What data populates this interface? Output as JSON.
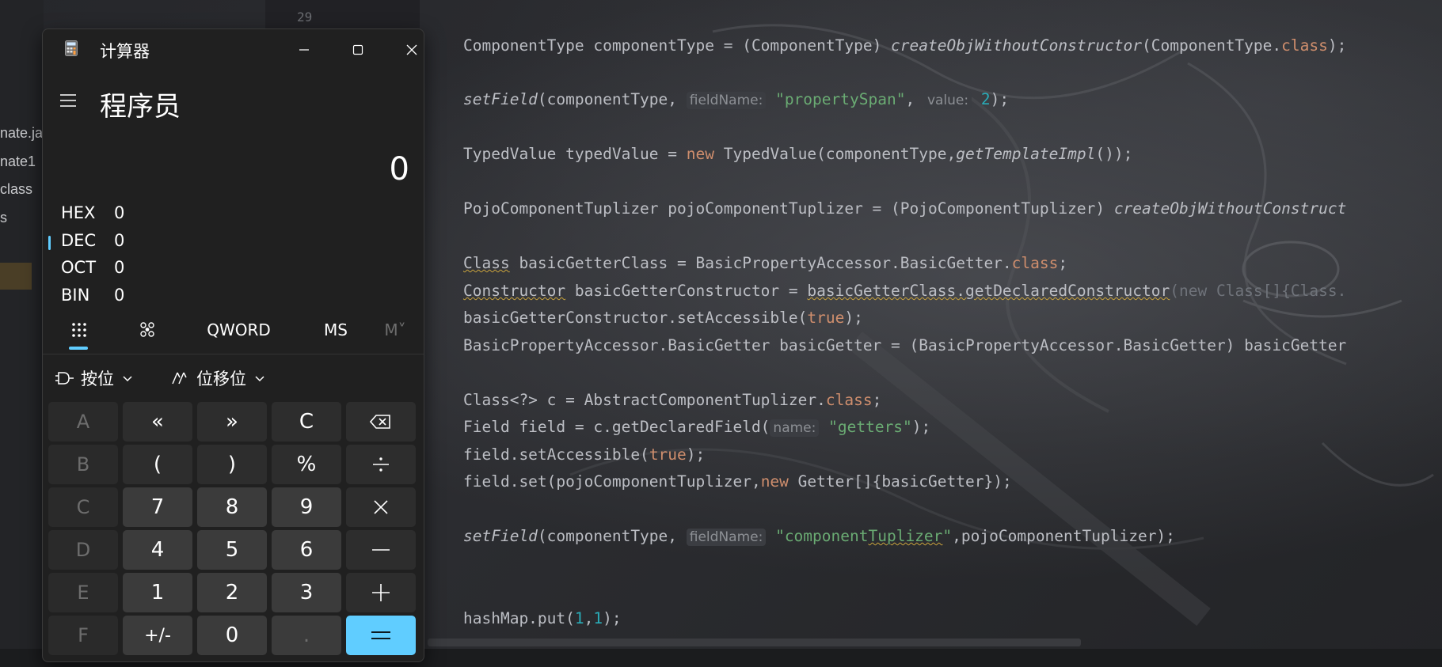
{
  "ide": {
    "gutter_line_number": "29",
    "project_items": [
      "nate.ja",
      "nate1",
      "class",
      "s"
    ],
    "code": {
      "line1": {
        "type": "ComponentType",
        "var": " componentType = (ComponentType) ",
        "call": "createObjWithoutConstructor",
        "arg": "(ComponentType.",
        "kw": "class",
        "end": ");"
      },
      "line2": {
        "call": "setField",
        "a": "(componentType, ",
        "hint1": "fieldName:",
        "s1": "\"propertySpan\"",
        "c": ", ",
        "hint2": "value:",
        "n": "2",
        "end": ");"
      },
      "line3": {
        "a": "TypedValue typedValue = ",
        "kw": "new",
        "b": " TypedValue(componentType,",
        "call": "getTemplateImpl",
        "end": "());"
      },
      "line4": {
        "a": "PojoComponentTuplizer pojoComponentTuplizer = (PojoComponentTuplizer) ",
        "call": "createObjWithoutConstruct"
      },
      "line5": {
        "a": "Class",
        "b": " basicGetterClass = BasicPropertyAccessor.BasicGetter.",
        "kw": "class",
        "end": ";"
      },
      "line6": {
        "a": "Constructor",
        "b": " basicGetterConstructor = ",
        "c": "basicGetterClass.getDeclaredConstructor",
        "d": "(new Class[]{Class."
      },
      "line7": {
        "a": "basicGetterConstructor.setAccessible(",
        "kw": "true",
        "end": ");"
      },
      "line8": {
        "a": "BasicPropertyAccessor.BasicGetter basicGetter = (BasicPropertyAccessor.BasicGetter) basicGetter"
      },
      "line9": {
        "a": "Class<?> c = AbstractComponentTuplizer.",
        "kw": "class",
        "end": ";"
      },
      "line10": {
        "a": "Field field = c.getDeclaredField(",
        "hint": "name:",
        "s": "\"getters\"",
        "end": ");"
      },
      "line11": {
        "a": "field.setAccessible(",
        "kw": "true",
        "end": ");"
      },
      "line12": {
        "a": "field.set(pojoComponentTuplizer,",
        "kw": "new",
        "end": " Getter[]{basicGetter});"
      },
      "line13": {
        "call": "setField",
        "a": "(componentType, ",
        "hint": "fieldName:",
        "s1": "\"component",
        "s2": "Tuplizer",
        "s3": "\"",
        "end": ",pojoComponentTuplizer);"
      },
      "line14": {
        "a": "hashMap.put(",
        "n1": "1",
        "c": ",",
        "n2": "1",
        "end": ");"
      }
    }
  },
  "calculator": {
    "title": "计算器",
    "mode": "程序员",
    "display": "0",
    "bases": [
      {
        "name": "HEX",
        "value": "0"
      },
      {
        "name": "DEC",
        "value": "0"
      },
      {
        "name": "OCT",
        "value": "0"
      },
      {
        "name": "BIN",
        "value": "0"
      }
    ],
    "toolbar": {
      "word_size": "QWORD",
      "ms": "MS",
      "m_dropdown": "M˅"
    },
    "bitwise_label": "按位",
    "bitshift_label": "位移位",
    "keys": {
      "A": "A",
      "B": "B",
      "C_hex": "C",
      "D": "D",
      "E": "E",
      "F": "F",
      "lshift": "«",
      "rshift": "»",
      "clear": "C",
      "lparen": "(",
      "rparen": ")",
      "percent": "%",
      "n7": "7",
      "n8": "8",
      "n9": "9",
      "n4": "4",
      "n5": "5",
      "n6": "6",
      "n1": "1",
      "n2": "2",
      "n3": "3",
      "negate": "+/-",
      "n0": "0",
      "dot": "."
    },
    "accent_color": "#60cdff"
  }
}
